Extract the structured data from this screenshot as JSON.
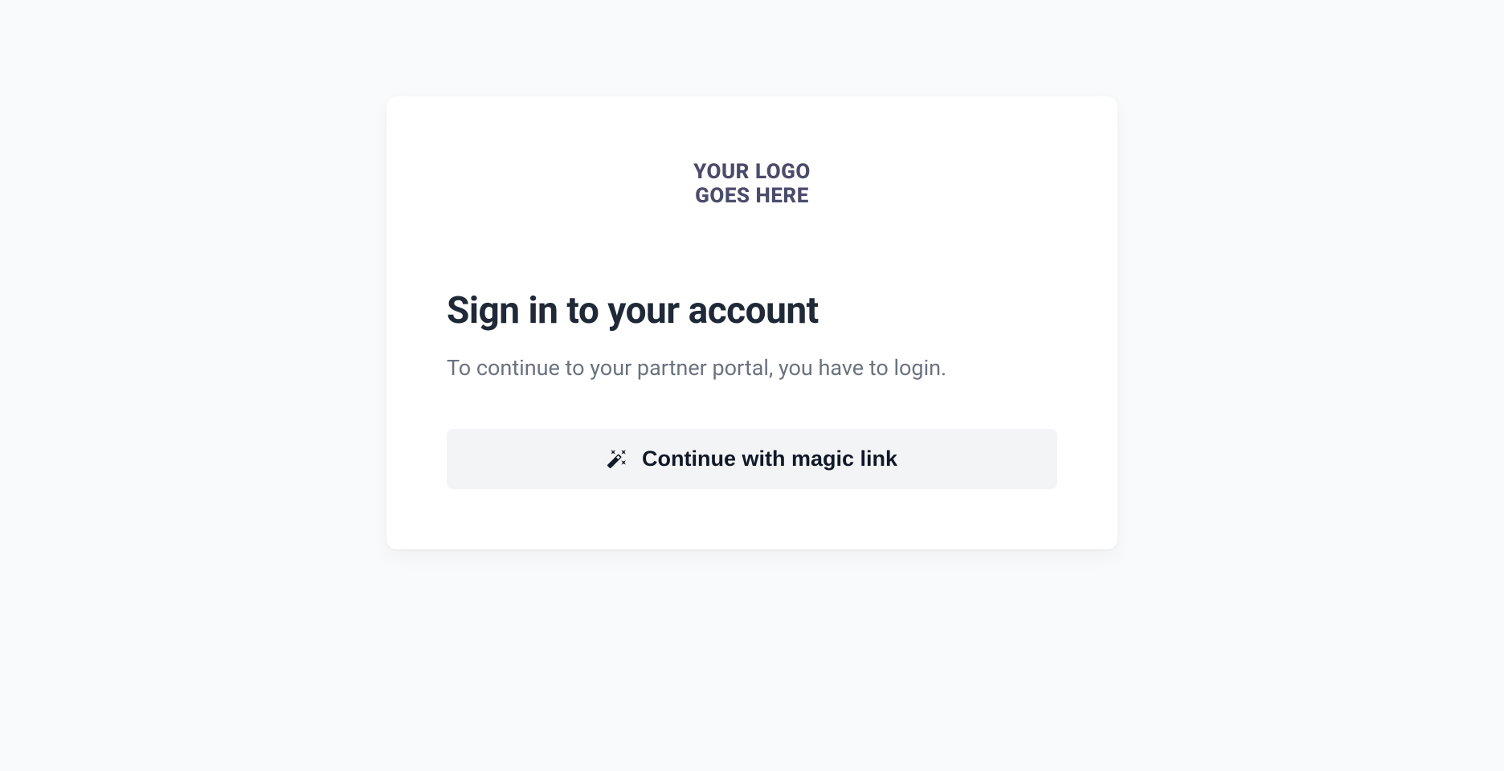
{
  "logo": {
    "line1": "YOUR LOGO",
    "line2": "GOES HERE"
  },
  "heading": "Sign in to your account",
  "subtext": "To continue to your partner portal, you have to login.",
  "button": {
    "label": "Continue with magic link"
  }
}
